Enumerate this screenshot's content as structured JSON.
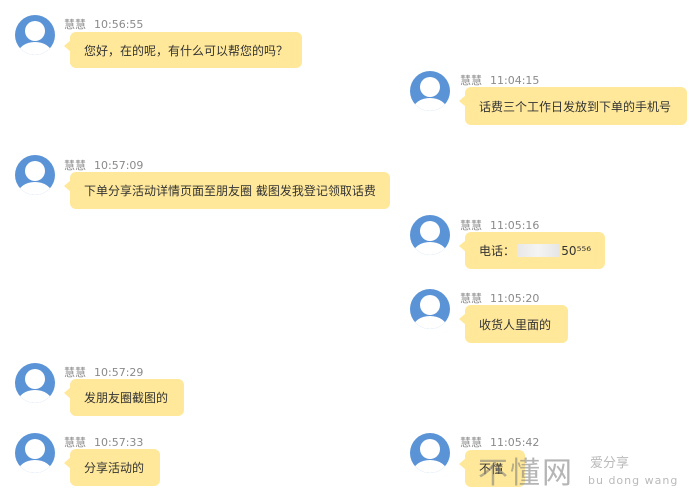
{
  "messages": [
    {
      "name": "慧慧",
      "time": "10:56:55",
      "text": "您好，在的呢，有什么可以帮您的吗？"
    },
    {
      "name": "慧慧",
      "time": "11:04:15",
      "text": "话费三个工作日发放到下单的手机号"
    },
    {
      "name": "慧慧",
      "time": "10:57:09",
      "text": "下单分享活动详情页面至朋友圈  截图发我登记领取话费"
    },
    {
      "name": "慧慧",
      "time": "11:05:16",
      "label": "电话：",
      "suffix": "50⁵⁵⁶"
    },
    {
      "name": "慧慧",
      "time": "11:05:20",
      "text": "收货人里面的"
    },
    {
      "name": "慧慧",
      "time": "10:57:29",
      "text": "发朋友圈截图的"
    },
    {
      "name": "慧慧",
      "time": "10:57:33",
      "text": "分享活动的"
    },
    {
      "name": "慧慧",
      "time": "11:05:42",
      "text": "不懂"
    }
  ],
  "watermark": {
    "main": "不懂网",
    "sub": "爱分享",
    "pinyin": "bu dong wang"
  },
  "colors": {
    "bubble": "#ffe89a",
    "avatar": "#5a93d6",
    "meta": "#8a8a8a"
  },
  "icons": {
    "avatar": "user-avatar-icon"
  }
}
